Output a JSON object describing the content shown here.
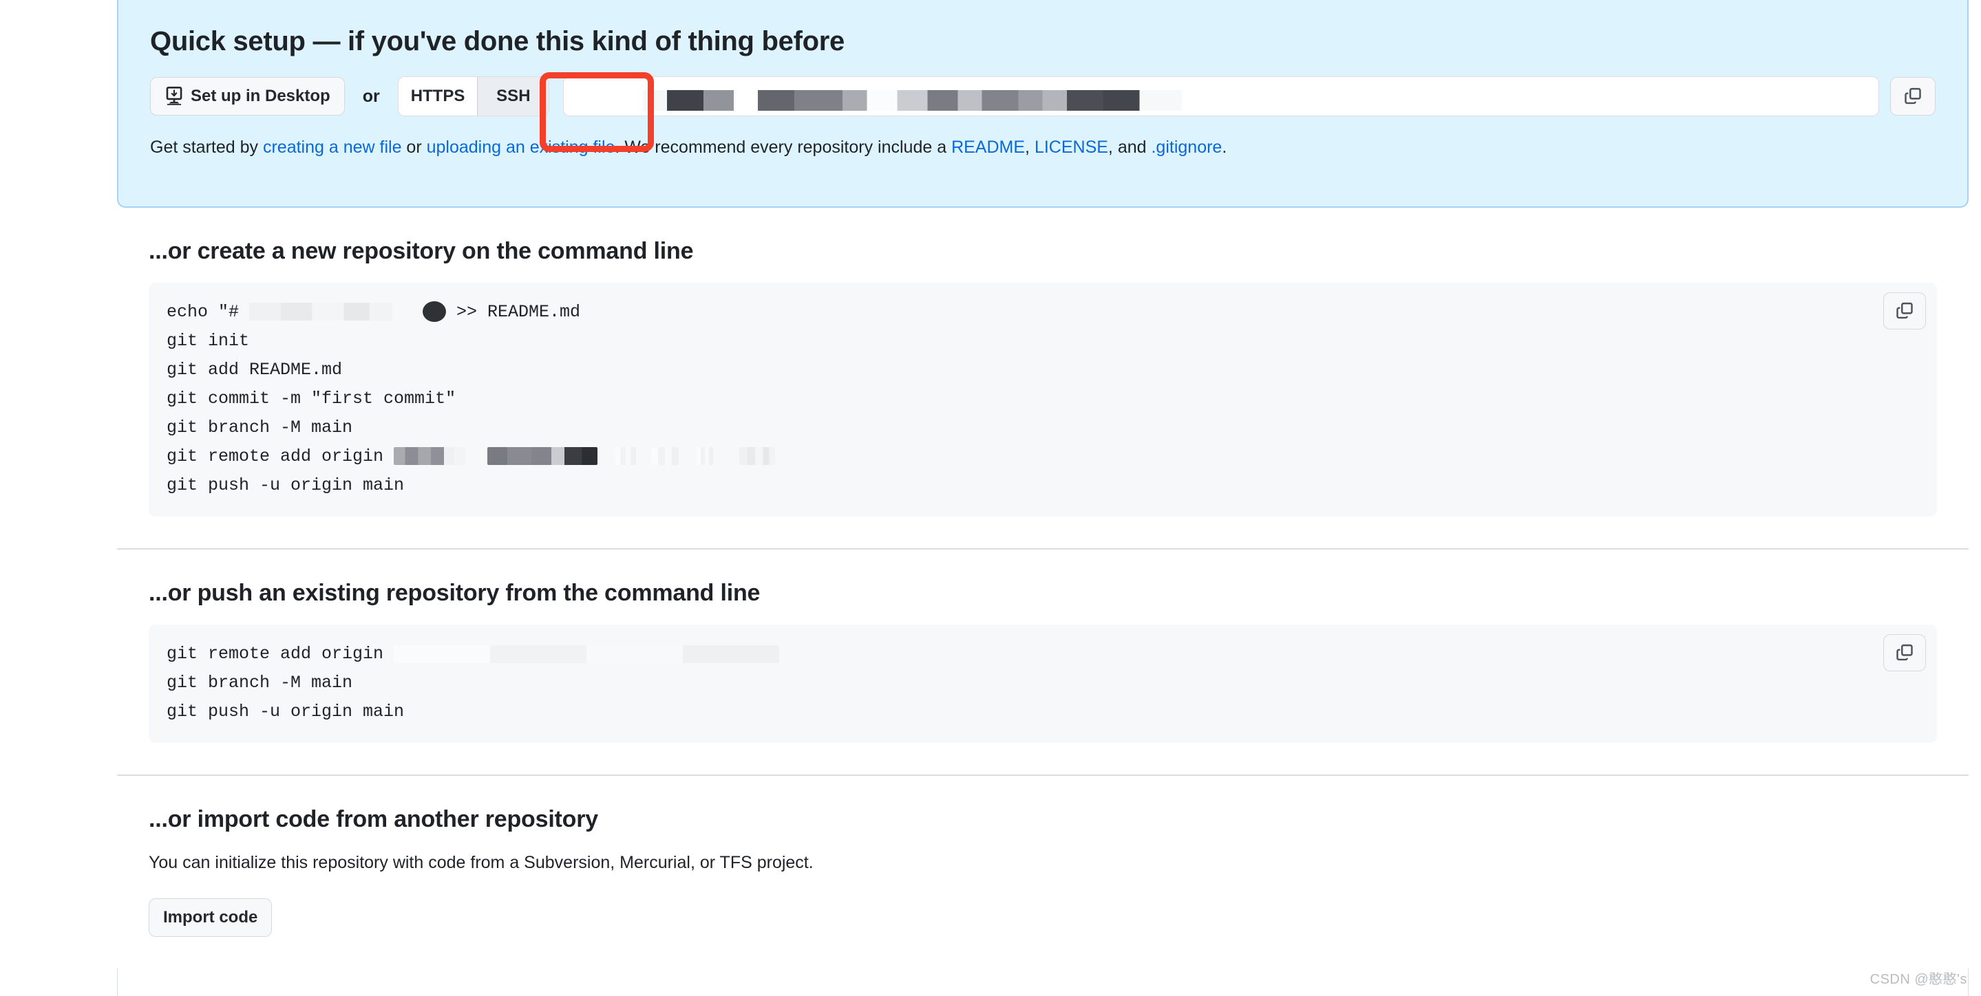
{
  "quick_setup": {
    "title": "Quick setup — if you've done this kind of thing before",
    "desktop_button_label": "Set up in Desktop",
    "or_label": "or",
    "protocols": [
      {
        "label": "HTTPS",
        "selected": false
      },
      {
        "label": "SSH",
        "selected": true
      }
    ],
    "clone_url_value": "",
    "clone_url_redacted": true,
    "copy_icon": "copy-icon",
    "desktop_icon": "desktop-download-icon",
    "hint": {
      "prefix": "Get started by ",
      "link_create": "creating a new file",
      "mid_or": " or ",
      "link_upload": "uploading an existing file",
      "mid_recommend": ". We recommend every repository include a ",
      "link_readme": "README",
      "sep1": ", ",
      "link_license": "LICENSE",
      "sep2": ", and ",
      "link_gitignore": ".gitignore",
      "suffix": "."
    }
  },
  "create_repo_section": {
    "title": "...or create a new repository on the command line",
    "copy_icon": "copy-icon",
    "lines": [
      {
        "pre": "echo \"# ",
        "redacted": true,
        "post": " >> README.md"
      },
      {
        "pre": "git init",
        "redacted": false,
        "post": ""
      },
      {
        "pre": "git add README.md",
        "redacted": false,
        "post": ""
      },
      {
        "pre": "git commit -m \"first commit\"",
        "redacted": false,
        "post": ""
      },
      {
        "pre": "git branch -M main",
        "redacted": false,
        "post": ""
      },
      {
        "pre": "git remote add origin ",
        "redacted": true,
        "post": ""
      },
      {
        "pre": "git push -u origin main",
        "redacted": false,
        "post": ""
      }
    ]
  },
  "push_repo_section": {
    "title": "...or push an existing repository from the command line",
    "copy_icon": "copy-icon",
    "lines": [
      {
        "pre": "git remote add origin ",
        "redacted": true,
        "post": ""
      },
      {
        "pre": "git branch -M main",
        "redacted": false,
        "post": ""
      },
      {
        "pre": "git push -u origin main",
        "redacted": false,
        "post": ""
      }
    ]
  },
  "import_section": {
    "title": "...or import code from another repository",
    "description": "You can initialize this repository with code from a Subversion, Mercurial, or TFS project.",
    "import_button_label": "Import code"
  },
  "annotation": {
    "color": "#f4402a",
    "target": "ssh-protocol-tab"
  },
  "watermark": {
    "text": "CSDN @憨憨's"
  },
  "colors": {
    "panel_bg": "#ddf4ff",
    "panel_border": "#a5d2f5",
    "link": "#0969da",
    "code_bg": "#f6f8fa",
    "button_bg": "#f6f8fa",
    "selected_tab_bg": "#eaeef2",
    "divider": "#d8dee4",
    "text": "#1f2328"
  }
}
